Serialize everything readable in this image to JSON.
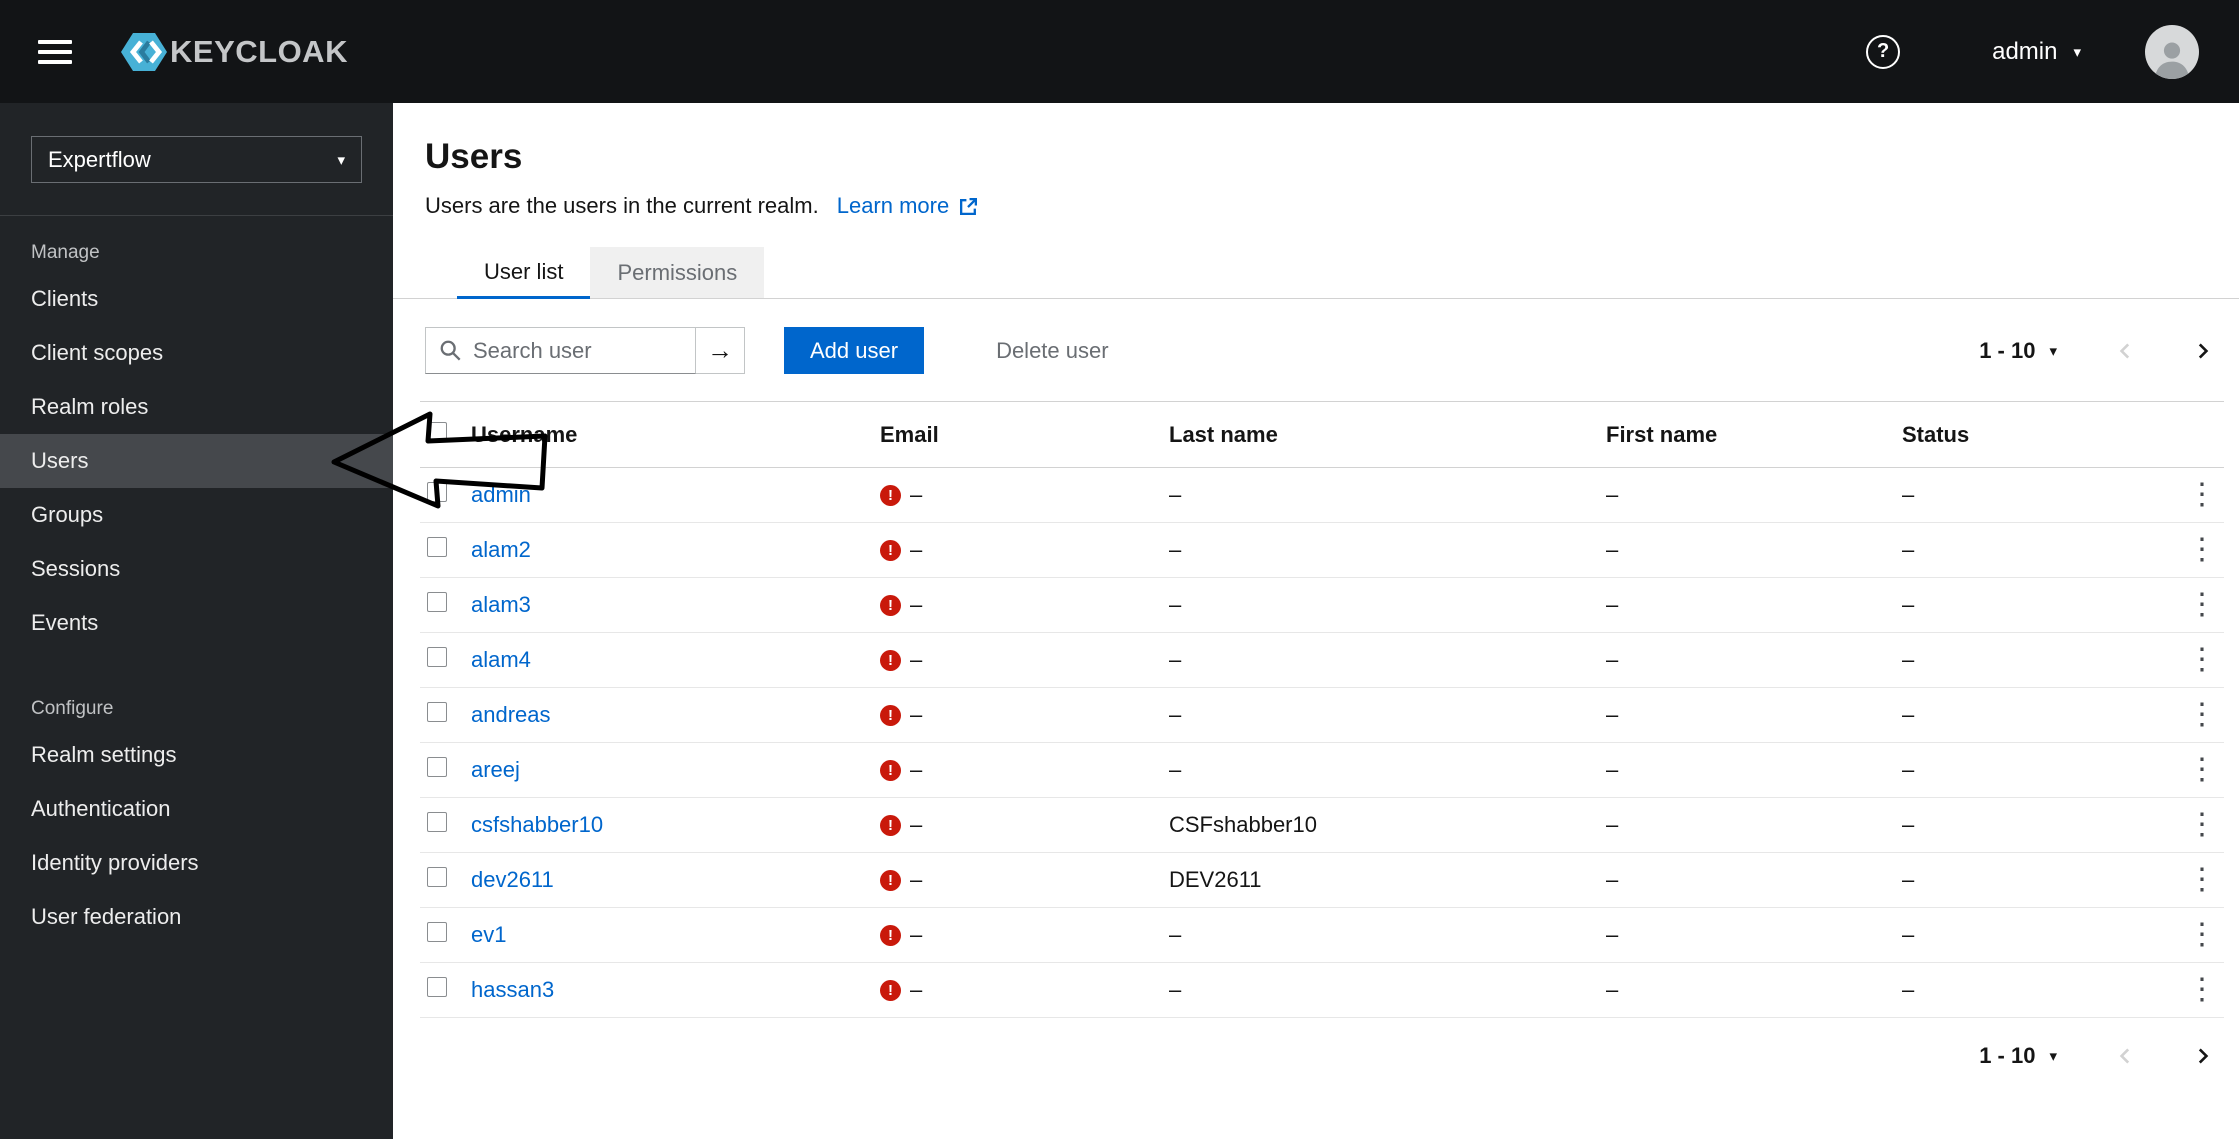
{
  "topbar": {
    "brand": "KEYCLOAK",
    "user_label": "admin"
  },
  "icons": {
    "caret": "▾",
    "kebab": "⋮",
    "question": "?",
    "warning": "!",
    "search_submit": "→"
  },
  "sidebar": {
    "realm": "Expertflow",
    "sections": [
      {
        "label": "Manage",
        "items": [
          "Clients",
          "Client scopes",
          "Realm roles",
          "Users",
          "Groups",
          "Sessions",
          "Events"
        ]
      },
      {
        "label": "Configure",
        "items": [
          "Realm settings",
          "Authentication",
          "Identity providers",
          "User federation"
        ]
      }
    ],
    "selected_item": "Users"
  },
  "page": {
    "title": "Users",
    "subtitle": "Users are the users in the current realm.",
    "learn_more": "Learn more",
    "tabs": {
      "user_list": "User list",
      "permissions": "Permissions"
    },
    "toolbar": {
      "search_placeholder": "Search user",
      "add_user": "Add user",
      "delete_user": "Delete user"
    },
    "pagination": {
      "label": "1 - 10"
    },
    "table": {
      "headers": {
        "username": "Username",
        "email": "Email",
        "last_name": "Last name",
        "first_name": "First name",
        "status": "Status"
      },
      "rows": [
        {
          "username": "admin",
          "email": "–",
          "last_name": "–",
          "first_name": "–",
          "status": "–"
        },
        {
          "username": "alam2",
          "email": "–",
          "last_name": "–",
          "first_name": "–",
          "status": "–"
        },
        {
          "username": "alam3",
          "email": "–",
          "last_name": "–",
          "first_name": "–",
          "status": "–"
        },
        {
          "username": "alam4",
          "email": "–",
          "last_name": "–",
          "first_name": "–",
          "status": "–"
        },
        {
          "username": "andreas",
          "email": "–",
          "last_name": "–",
          "first_name": "–",
          "status": "–"
        },
        {
          "username": "areej",
          "email": "–",
          "last_name": "–",
          "first_name": "–",
          "status": "–"
        },
        {
          "username": "csfshabber10",
          "email": "–",
          "last_name": "CSFshabber10",
          "first_name": "–",
          "status": "–"
        },
        {
          "username": "dev2611",
          "email": "–",
          "last_name": "DEV2611",
          "first_name": "–",
          "status": "–"
        },
        {
          "username": "ev1",
          "email": "–",
          "last_name": "–",
          "first_name": "–",
          "status": "–"
        },
        {
          "username": "hassan3",
          "email": "–",
          "last_name": "–",
          "first_name": "–",
          "status": "–"
        }
      ]
    }
  }
}
